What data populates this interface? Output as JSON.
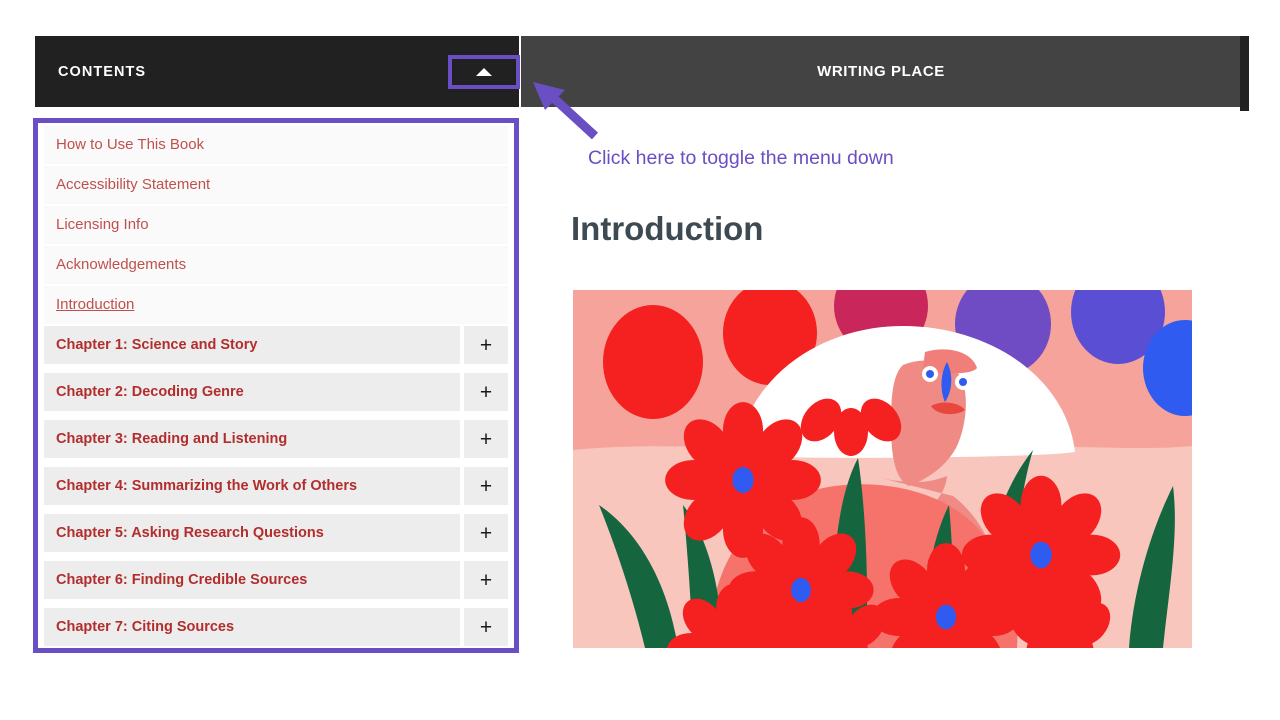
{
  "sidebar": {
    "header_title": "CONTENTS",
    "toggle": {
      "name": "toggle-contents-menu",
      "icon": "caret-up-icon",
      "label": ""
    },
    "front_matter": [
      {
        "label": "How to Use This Book",
        "current": false
      },
      {
        "label": "Accessibility Statement",
        "current": false
      },
      {
        "label": "Licensing Info",
        "current": false
      },
      {
        "label": "Acknowledgements",
        "current": false
      },
      {
        "label": "Introduction",
        "current": true
      }
    ],
    "chapters": [
      {
        "label": "Chapter 1: Science and Story",
        "expander": "+"
      },
      {
        "label": "Chapter 2: Decoding Genre",
        "expander": "+"
      },
      {
        "label": "Chapter 3: Reading and Listening",
        "expander": "+"
      },
      {
        "label": "Chapter 4: Summarizing the Work of Others",
        "expander": "+"
      },
      {
        "label": "Chapter 5: Asking Research Questions",
        "expander": "+"
      },
      {
        "label": "Chapter 6: Finding Credible Sources",
        "expander": "+"
      },
      {
        "label": "Chapter 7: Citing Sources",
        "expander": "+"
      }
    ]
  },
  "content": {
    "header_title": "WRITING PLACE",
    "page_heading": "Introduction",
    "figure_alt": "Flat illustration of a face among large red daisies with blue centers, green leaves, pink background and red, magenta, purple and blue circles"
  },
  "annotation": {
    "text": "Click here to toggle the menu down",
    "arrow": "annotation-arrow-up-left"
  },
  "colors": {
    "sidebar_header_bg": "#212121",
    "content_header_bg": "#434343",
    "highlight_purple": "#6a4fc4",
    "front_link_red": "#c0504d",
    "chapter_link_red": "#b32d2d",
    "chapter_row_bg": "#ededed",
    "front_row_bg": "#fafafa",
    "heading_slate": "#3e4a52"
  }
}
